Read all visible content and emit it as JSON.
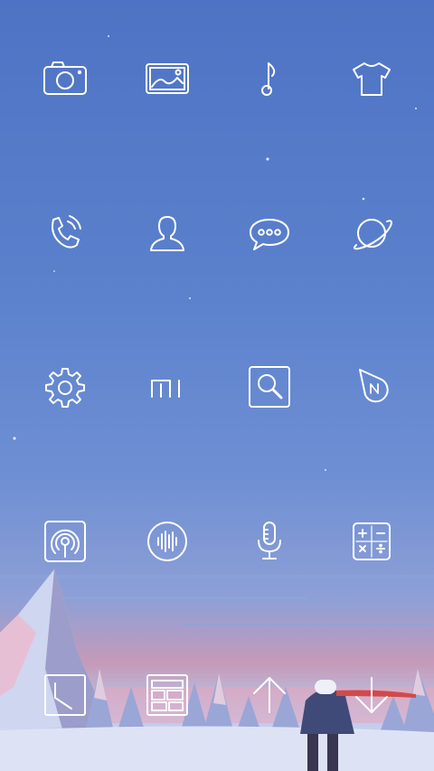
{
  "screen": "home-screen",
  "theme": {
    "icon_color": "#ffffff",
    "sky_top": "#4f73c4",
    "horizon_pink": "#e6a0b8",
    "snow": "#dfe6f6"
  },
  "icons": [
    {
      "name": "camera-icon"
    },
    {
      "name": "gallery-icon"
    },
    {
      "name": "music-icon"
    },
    {
      "name": "themes-icon"
    },
    {
      "name": "phone-icon"
    },
    {
      "name": "contacts-icon"
    },
    {
      "name": "messages-icon"
    },
    {
      "name": "browser-icon"
    },
    {
      "name": "settings-icon"
    },
    {
      "name": "mi-icon",
      "text": "MI"
    },
    {
      "name": "search-icon"
    },
    {
      "name": "compass-icon",
      "text": "N"
    },
    {
      "name": "hotspot-icon"
    },
    {
      "name": "voice-recorder-icon"
    },
    {
      "name": "microphone-icon"
    },
    {
      "name": "calculator-icon",
      "text": [
        "+",
        "−",
        "×",
        "÷"
      ]
    },
    {
      "name": "clock-icon"
    },
    {
      "name": "apps-grid-icon"
    },
    {
      "name": "update-arrow-icon"
    },
    {
      "name": "download-arrow-icon"
    }
  ]
}
